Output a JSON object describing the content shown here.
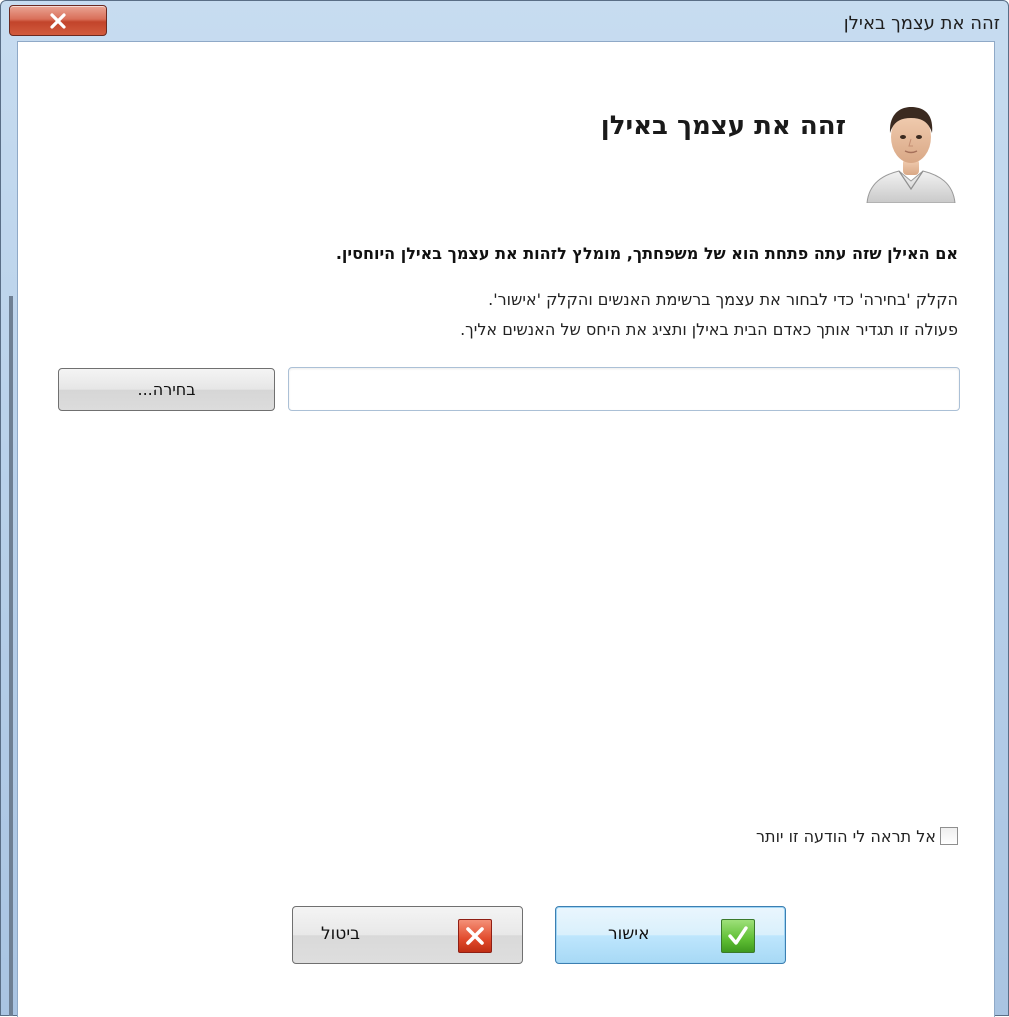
{
  "window": {
    "title": "זהה את עצמך באילן"
  },
  "dialog": {
    "heading": "זהה את עצמך באילן",
    "bold_message": "אם האילן שזה עתה פתחת הוא של משפחתך, מומלץ לזהות את עצמך באילן היוחסין.",
    "instruction_line1": "הקלק 'בחירה' כדי לבחור את עצמך ברשימת האנשים והקלק 'אישור'.",
    "instruction_line2": "פעולה זו תגדיר אותך כאדם הבית באילן ותציג את היחס של האנשים אליך.",
    "person_field_value": "",
    "choose_button": "בחירה...",
    "dont_show_checkbox": {
      "label": "אל תראה לי הודעה זו יותר",
      "checked": false
    },
    "ok_button": "אישור",
    "cancel_button": "ביטול"
  },
  "icons": {
    "close": "close-icon",
    "avatar": "person-avatar-icon",
    "ok": "checkmark-icon",
    "cancel": "x-icon"
  },
  "colors": {
    "close_button": "#c2442b",
    "ok_icon": "#5fbf34",
    "cancel_icon": "#e14a2c",
    "title_bar": "#b9d1ea"
  }
}
